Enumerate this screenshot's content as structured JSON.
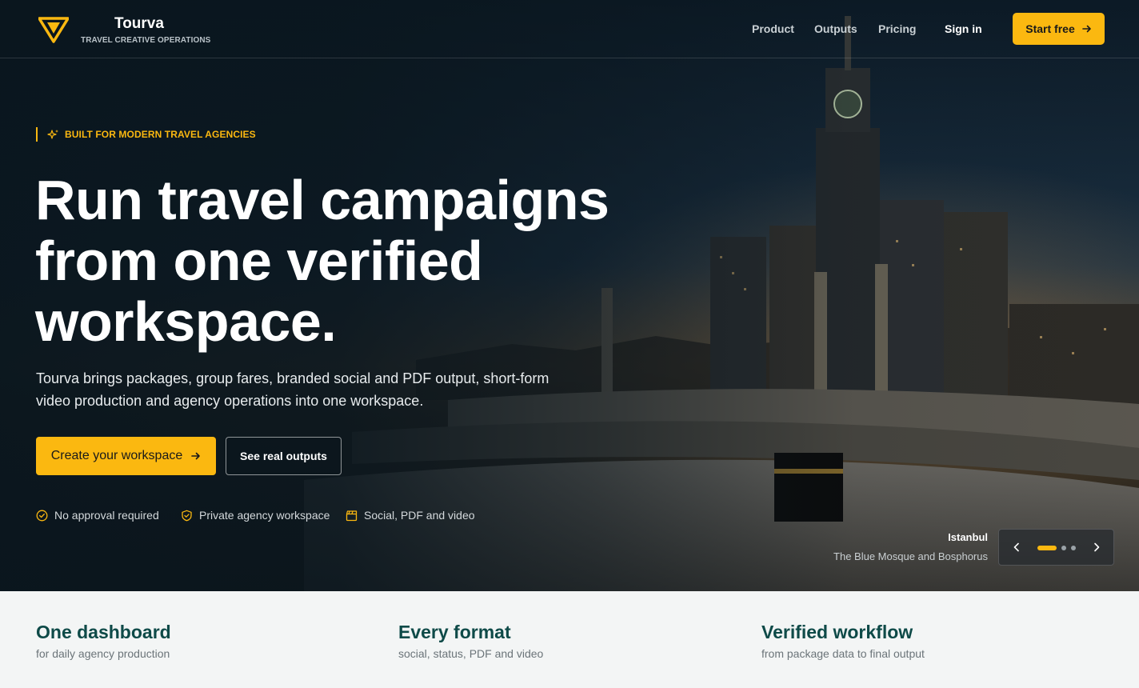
{
  "brand": {
    "name": "Tourva",
    "tagline": "TRAVEL CREATIVE OPERATIONS"
  },
  "nav": {
    "links": [
      "Product",
      "Outputs",
      "Pricing"
    ],
    "sign_in": "Sign in",
    "cta": "Start free"
  },
  "hero": {
    "eyebrow": "BUILT FOR MODERN TRAVEL AGENCIES",
    "headline_lines": [
      "Run travel campaigns",
      "from one verified",
      "workspace."
    ],
    "subtext_lines": [
      "Tourva brings packages, group fares, branded social and PDF output, short-form",
      "video production and agency operations into one workspace."
    ],
    "primary_cta": "Create your workspace",
    "secondary_cta": "See real outputs",
    "trust": [
      {
        "icon": "check-circle-icon",
        "label": "No approval required"
      },
      {
        "icon": "shield-check-icon",
        "label": "Private agency workspace"
      },
      {
        "icon": "clapperboard-icon",
        "label": "Social, PDF and video"
      }
    ]
  },
  "slide": {
    "title": "Istanbul",
    "subtitle": "The Blue Mosque and Bosphorus",
    "count": 3,
    "active": 0
  },
  "stats": [
    {
      "title": "One dashboard",
      "subtitle": "for daily agency production"
    },
    {
      "title": "Every format",
      "subtitle": "social, status, PDF and video"
    },
    {
      "title": "Verified workflow",
      "subtitle": "from package data to final output"
    }
  ],
  "colors": {
    "accent": "#fbb810",
    "stat_title": "#0e4a48",
    "hero_bg": "#0b1822"
  }
}
